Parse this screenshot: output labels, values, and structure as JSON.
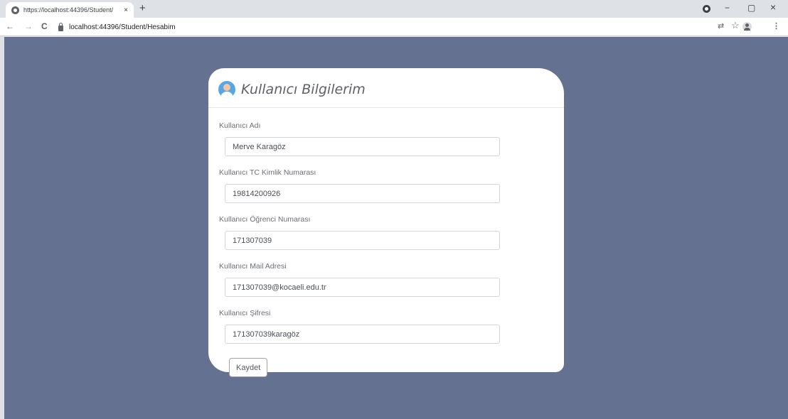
{
  "browser": {
    "tab_title": "https://localhost:44396/Student/",
    "tab_close": "×",
    "new_tab": "+",
    "url": "localhost:44396/Student/Hesabim",
    "nav": {
      "back": "←",
      "forward": "→",
      "reload": "C"
    },
    "window": {
      "minimize": "−",
      "maximize": "▢",
      "close": "×"
    },
    "toolbar_icons": {
      "translate": "⇄",
      "bookmark": "☆",
      "menu": "⋮"
    }
  },
  "card": {
    "title": "Kullanıcı Bilgilerim",
    "fields": [
      {
        "label": "Kullanıcı Adı",
        "value": "Merve Karagöz"
      },
      {
        "label": "Kullanıcı TC Kimlik Numarası",
        "value": "19814200926"
      },
      {
        "label": "Kullanıcı Öğrenci Numarası",
        "value": "171307039"
      },
      {
        "label": "Kullanıcı Mail Adresi",
        "value": "171307039@kocaeli.edu.tr"
      },
      {
        "label": "Kullanıcı Şifresi",
        "value": "171307039karagöz"
      }
    ],
    "save_label": "Kaydet"
  },
  "colors": {
    "page_background": "#657190",
    "card_background": "#ffffff",
    "icon_blue": "#5aa6e3"
  }
}
